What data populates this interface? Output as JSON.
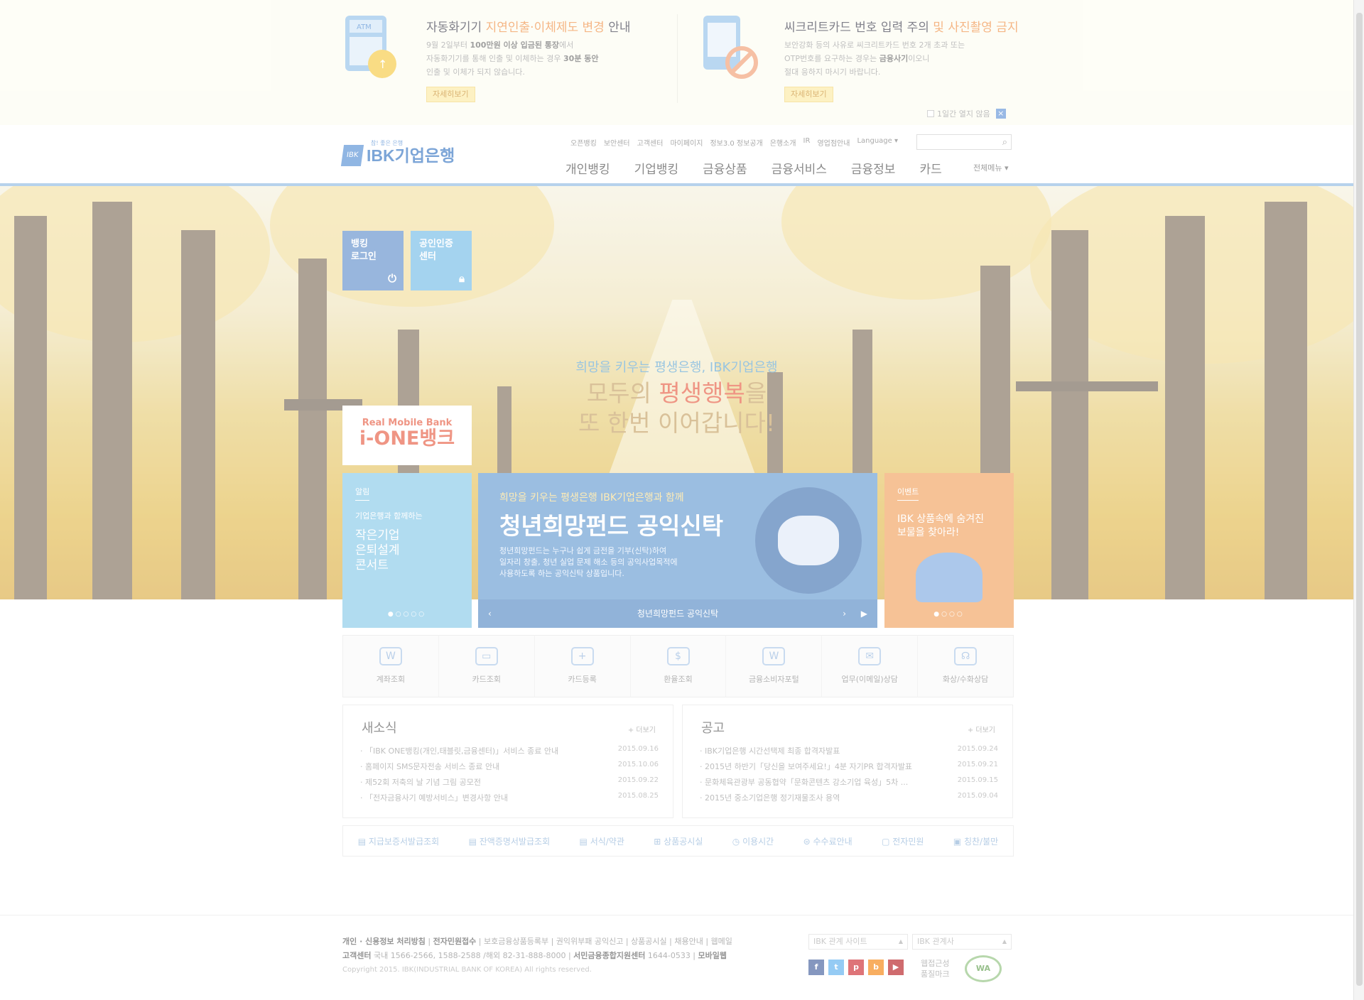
{
  "notice": {
    "left": {
      "title_pre": "자동화기기 ",
      "title_hl": "지연인출·이체제도 변경",
      "title_post": " 안내",
      "desc1_pre": "9월 2일부터 ",
      "desc1_bold": "100만원 이상 입금된 통장",
      "desc1_post": "에서",
      "desc2_pre": "자동화기기를 통해 인출 및 이체하는 경우 ",
      "desc2_bold": "30분 동안",
      "desc3": "인출 및 이체가 되지 않습니다.",
      "more": "자세히보기",
      "icon": "atm-icon",
      "icon_label": "ATM"
    },
    "right": {
      "title_pre": "씨크리트카드 번호 입력 주의 ",
      "title_hl": "및 사진촬영 금지",
      "desc1": "보안강화 등의 사유로 씨크리트카드 번호 2개 초과 또는",
      "desc2_pre": "OTP번호를 요구하는 경우는 ",
      "desc2_bold": "금융사기",
      "desc2_post": "이오니",
      "desc3": "절대 응하지 마시기 바랍니다.",
      "more": "자세히보기",
      "icon": "no-photo-icon"
    },
    "close_label": "1일간 열지 않음"
  },
  "header": {
    "logo_tag": "참! 좋은 은행",
    "logo_name": "IBK기업은행",
    "logo_mark": "IBK",
    "util": [
      "오픈뱅킹",
      "보안센터",
      "고객센터",
      "마이페이지",
      "정보3.0 정보공개",
      "은행소개",
      "IR",
      "영업점안내",
      "Language ▾"
    ],
    "gnb": [
      "개인뱅킹",
      "기업뱅킹",
      "금융상품",
      "금융서비스",
      "금융정보",
      "카드"
    ],
    "all_menu": "전체메뉴 ▾"
  },
  "hero": {
    "login": "뱅킹\n로그인",
    "login_l1": "뱅킹",
    "login_l2": "로그인",
    "cert_l1": "공인인증",
    "cert_l2": "센터",
    "copy1": "희망을 키우는 평생은행, IBK기업은행",
    "copy2_pre": "모두의 ",
    "copy2_hl": "평생행복",
    "copy2_post": "을",
    "copy3": "또 한번 이어갑니다!",
    "ione_a": "Real Mobile Bank",
    "ione_b": "i-ONE뱅크"
  },
  "panels": {
    "left": {
      "cat": "알림",
      "l1": "기업은행과 함께하는",
      "l2": "작은기업",
      "l3": "은퇴설계",
      "l4": "콘서트",
      "dots": "●○○○○"
    },
    "center": {
      "kick": "희망을 키우는 평생은행 IBK기업은행과 함께",
      "big": "청년희망펀드 공익신탁",
      "s1": "청년희망펀드는 누구나 쉽게 금전을 기부(신탁)하여",
      "s2": "일자리 창출, 청년 실업 문제 해소 등의 공익사업목적에",
      "s3": "사용하도록 하는 공익신탁 상품입니다.",
      "bar": "청년희망펀드 공익신탁",
      "prev": "‹",
      "next": "›",
      "play": "▶"
    },
    "right": {
      "cat": "이벤트",
      "l1": "IBK 상품속에 숨겨진",
      "l2": "보물을 찾아라!",
      "dots": "●○○○"
    }
  },
  "quick": [
    {
      "label": "계좌조회",
      "icon": "account-search-icon",
      "glyph": "W"
    },
    {
      "label": "카드조회",
      "icon": "card-search-icon",
      "glyph": "▭"
    },
    {
      "label": "카드등록",
      "icon": "card-add-icon",
      "glyph": "+"
    },
    {
      "label": "환율조회",
      "icon": "exchange-rate-icon",
      "glyph": "$"
    },
    {
      "label": "금융소비자포털",
      "icon": "consumer-portal-icon",
      "glyph": "W"
    },
    {
      "label": "업무(이메일)상담",
      "icon": "email-icon",
      "glyph": "✉"
    },
    {
      "label": "화상/수화상담",
      "icon": "headset-icon",
      "glyph": "☊"
    }
  ],
  "news": {
    "title": "새소식",
    "more": "+ 더보기",
    "items": [
      {
        "t": "· 「IBK ONE뱅킹(개인,태블릿,금융센터)」서비스 종료 안내",
        "d": "2015.09.16"
      },
      {
        "t": "· 홈페이지 SMS문자전송 서비스 종료 안내",
        "d": "2015.10.06"
      },
      {
        "t": "· 제52회 저축의 날 기념 그림 공모전",
        "d": "2015.09.22"
      },
      {
        "t": "· 「전자금융사기 예방서비스」변경사항 안내",
        "d": "2015.08.25"
      }
    ]
  },
  "notice_board": {
    "title": "공고",
    "more": "+ 더보기",
    "items": [
      {
        "t": "· IBK기업은행 시간선택제 최종 합격자발표",
        "d": "2015.09.24"
      },
      {
        "t": "· 2015년 하반기「당신을 보여주세요!」4분 자기PR 합격자발표",
        "d": "2015.09.21"
      },
      {
        "t": "· 문화체육관광부 공동협약「문화콘텐츠 강소기업 육성」5차 ...",
        "d": "2015.09.15"
      },
      {
        "t": "· 2015년 중소기업은행 정기재물조사 용역",
        "d": "2015.09.04"
      }
    ]
  },
  "links": [
    "지급보증서발급조회",
    "잔액증명서발급조회",
    "서식/약관",
    "상품공시실",
    "이용시간",
    "수수료안내",
    "전자민원",
    "칭찬/불만"
  ],
  "footer": {
    "l1a": "개인 · 신용정보 처리방침",
    "l1b": "전자민원접수",
    "l1c": " | 보호금융상품등록부 | 권익위부패 공익신고 | 상품공시실 | 채용안내 | 웹메일",
    "l2a": "고객센터",
    "l2b": " 국내 1566-2566, 1588-2588 /해외 82-31-888-8000 | ",
    "l2c": "서민금융종합지원센터",
    "l2d": " 1644-0533 | ",
    "l2e": "모바일웹",
    "copyright": "Copyright 2015. IBK(INDUSTRIAL BANK OF KOREA) All rights reserved.",
    "sel1": "IBK 관계 사이트",
    "sel2": "IBK 관계사",
    "cert1": "웹접근성",
    "cert2": "품질마크",
    "cert_mark": "WA",
    "sns": [
      {
        "name": "facebook-icon",
        "glyph": "f",
        "color": "#3b5998"
      },
      {
        "name": "twitter-icon",
        "glyph": "t",
        "color": "#55acee"
      },
      {
        "name": "pinterest-icon",
        "glyph": "p",
        "color": "#cb2027"
      },
      {
        "name": "blog-icon",
        "glyph": "b",
        "color": "#f57d00"
      },
      {
        "name": "youtube-icon",
        "glyph": "▶",
        "color": "#b31217"
      }
    ]
  },
  "colors": {
    "brand": "#2d6fc0",
    "accent": "#e6553a",
    "sky": "#83c7e8",
    "orange": "#f19e56"
  }
}
